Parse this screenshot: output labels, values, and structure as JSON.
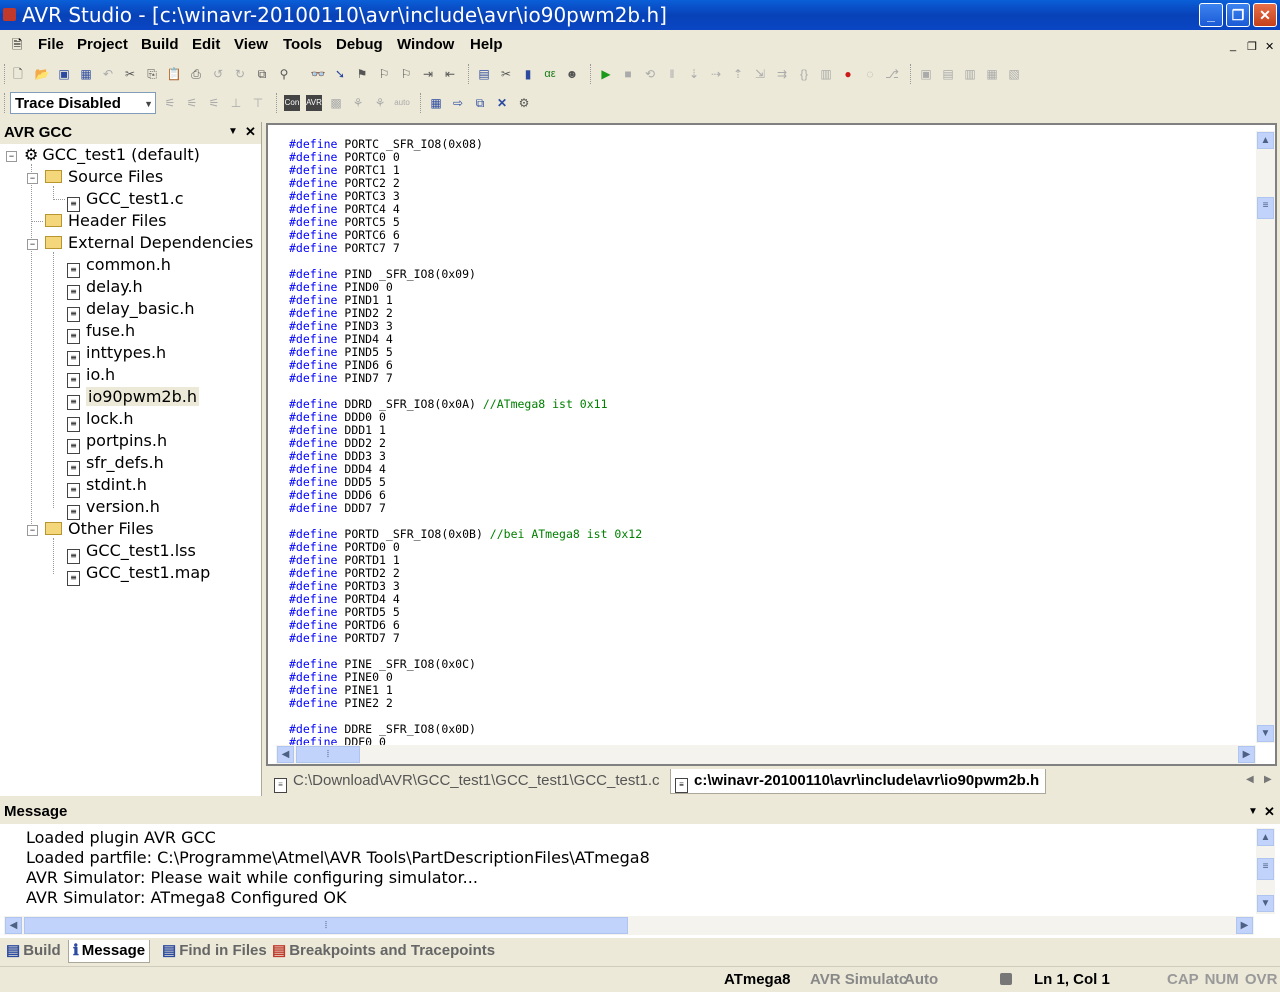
{
  "window": {
    "title": "AVR Studio - [c:\\winavr-20100110\\avr\\include\\avr\\io90pwm2b.h]"
  },
  "menu": [
    "File",
    "Project",
    "Build",
    "Edit",
    "View",
    "Tools",
    "Debug",
    "Window",
    "Help"
  ],
  "toolbar": {
    "trace_mode": "Trace Disabled"
  },
  "left_panel": {
    "title": "AVR GCC",
    "project": "GCC_test1 (default)",
    "folders": {
      "source": "Source Files",
      "header": "Header Files",
      "external": "External Dependencies",
      "other": "Other Files"
    },
    "source_files": [
      "GCC_test1.c"
    ],
    "external_files": [
      "common.h",
      "delay.h",
      "delay_basic.h",
      "fuse.h",
      "inttypes.h",
      "io.h",
      "io90pwm2b.h",
      "lock.h",
      "portpins.h",
      "sfr_defs.h",
      "stdint.h",
      "version.h"
    ],
    "other_files": [
      "GCC_test1.lss",
      "GCC_test1.map"
    ]
  },
  "editor": {
    "keyword": "#define",
    "lines": [
      {
        "t": "PORTC _SFR_IO8(0x08)"
      },
      {
        "t": "PORTC0 0"
      },
      {
        "t": "PORTC1 1"
      },
      {
        "t": "PORTC2 2"
      },
      {
        "t": "PORTC3 3"
      },
      {
        "t": "PORTC4 4"
      },
      {
        "t": "PORTC5 5"
      },
      {
        "t": "PORTC6 6"
      },
      {
        "t": "PORTC7 7"
      },
      {
        "blank": true
      },
      {
        "t": "PIND _SFR_IO8(0x09)"
      },
      {
        "t": "PIND0 0"
      },
      {
        "t": "PIND1 1"
      },
      {
        "t": "PIND2 2"
      },
      {
        "t": "PIND3 3"
      },
      {
        "t": "PIND4 4"
      },
      {
        "t": "PIND5 5"
      },
      {
        "t": "PIND6 6"
      },
      {
        "t": "PIND7 7"
      },
      {
        "blank": true
      },
      {
        "t": "DDRD _SFR_IO8(0x0A) ",
        "c": "//ATmega8 ist 0x11"
      },
      {
        "t": "DDD0 0"
      },
      {
        "t": "DDD1 1"
      },
      {
        "t": "DDD2 2"
      },
      {
        "t": "DDD3 3"
      },
      {
        "t": "DDD4 4"
      },
      {
        "t": "DDD5 5"
      },
      {
        "t": "DDD6 6"
      },
      {
        "t": "DDD7 7"
      },
      {
        "blank": true
      },
      {
        "t": "PORTD _SFR_IO8(0x0B) ",
        "c": "//bei ATmega8 ist 0x12"
      },
      {
        "t": "PORTD0 0"
      },
      {
        "t": "PORTD1 1"
      },
      {
        "t": "PORTD2 2"
      },
      {
        "t": "PORTD3 3"
      },
      {
        "t": "PORTD4 4"
      },
      {
        "t": "PORTD5 5"
      },
      {
        "t": "PORTD6 6"
      },
      {
        "t": "PORTD7 7"
      },
      {
        "blank": true
      },
      {
        "t": "PINE _SFR_IO8(0x0C)"
      },
      {
        "t": "PINE0 0"
      },
      {
        "t": "PINE1 1"
      },
      {
        "t": "PINE2 2"
      },
      {
        "blank": true
      },
      {
        "t": "DDRE _SFR_IO8(0x0D)"
      },
      {
        "t": "DDE0 0"
      }
    ]
  },
  "doc_tabs": [
    "C:\\Download\\AVR\\GCC_test1\\GCC_test1\\GCC_test1.c",
    "c:\\winavr-20100110\\avr\\include\\avr\\io90pwm2b.h"
  ],
  "message_panel": {
    "title": "Message",
    "lines": [
      "Loaded plugin AVR GCC",
      "Loaded partfile: C:\\Programme\\Atmel\\AVR Tools\\PartDescriptionFiles\\ATmega8",
      "AVR Simulator: Please wait while configuring simulator...",
      "AVR Simulator: ATmega8 Configured OK"
    ]
  },
  "bottom_tabs": [
    "Build",
    "Message",
    "Find in Files",
    "Breakpoints and Tracepoints"
  ],
  "status": {
    "device": "ATmega8",
    "platform": "AVR Simulatc",
    "mode": "Auto",
    "position": "Ln 1, Col 1",
    "keys": "CAP  NUM  OVR"
  }
}
